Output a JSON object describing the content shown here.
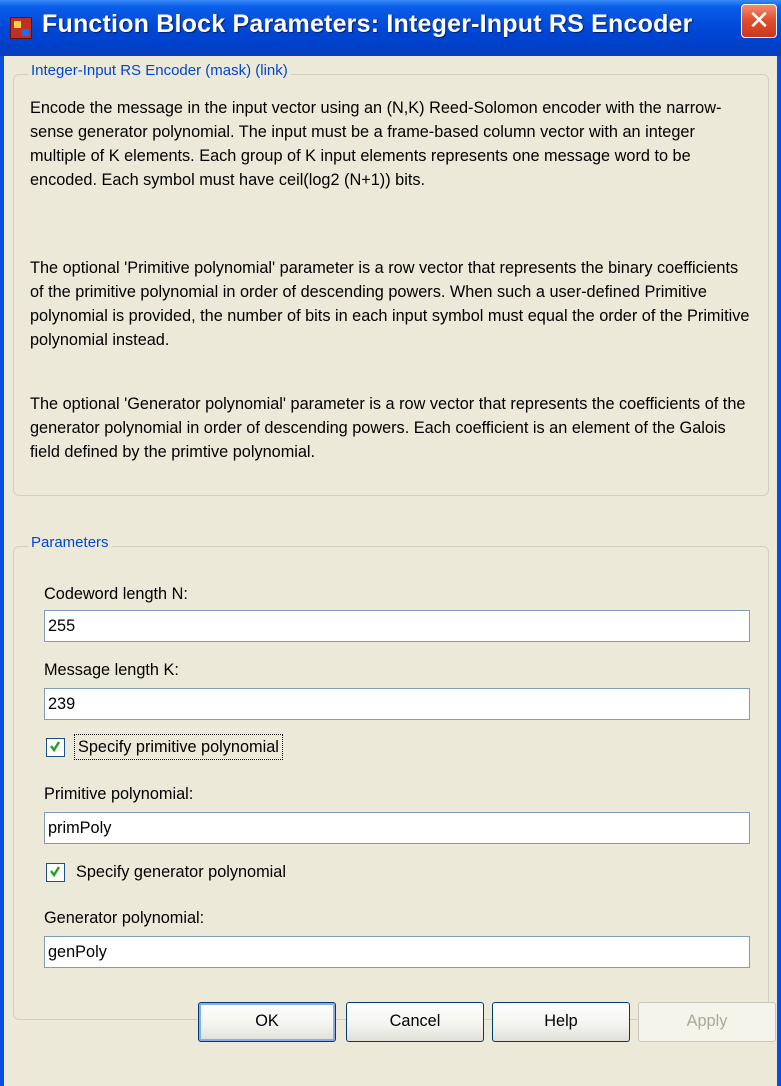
{
  "window": {
    "title": "Function Block Parameters: Integer-Input RS Encoder",
    "close_glyph": "✕"
  },
  "description_group": {
    "legend": "Integer-Input RS Encoder (mask) (link)",
    "paragraphs": [
      "Encode the message in the input vector using an (N,K) Reed-Solomon encoder with the narrow-sense generator polynomial.  The input must be a frame-based column vector with an integer multiple of K elements.  Each group of K input elements represents one message word to be encoded.  Each symbol must have ceil(log2 (N+1)) bits.",
      "The optional 'Primitive polynomial' parameter is a row vector that represents the binary coefficients of the primitive polynomial in order of descending powers.  When such a user-defined Primitive polynomial is provided, the number of bits in each input symbol must equal the order of the Primitive polynomial instead.",
      "The optional 'Generator polynomial' parameter is a row vector that represents the coefficients of the generator polynomial in order of descending powers.  Each coefficient is an element of the Galois field defined by the primtive polynomial."
    ]
  },
  "parameters": {
    "legend": "Parameters",
    "codeword_length": {
      "label": "Codeword length N:",
      "value": "255"
    },
    "message_length": {
      "label": "Message length K:",
      "value": "239"
    },
    "specify_primitive": {
      "label": "Specify primitive polynomial",
      "checked": true
    },
    "primitive_polynomial": {
      "label": "Primitive polynomial:",
      "value": "primPoly"
    },
    "specify_generator": {
      "label": "Specify generator polynomial",
      "checked": true
    },
    "generator_polynomial": {
      "label": "Generator polynomial:",
      "value": "genPoly"
    }
  },
  "buttons": {
    "ok": "OK",
    "cancel": "Cancel",
    "help": "Help",
    "apply": "Apply"
  },
  "colors": {
    "titlebar": "#0048d8",
    "dialog_bg": "#ece9d8",
    "legend_text": "#0046d5",
    "close_button": "#e05030",
    "check_mark": "#21a121"
  }
}
